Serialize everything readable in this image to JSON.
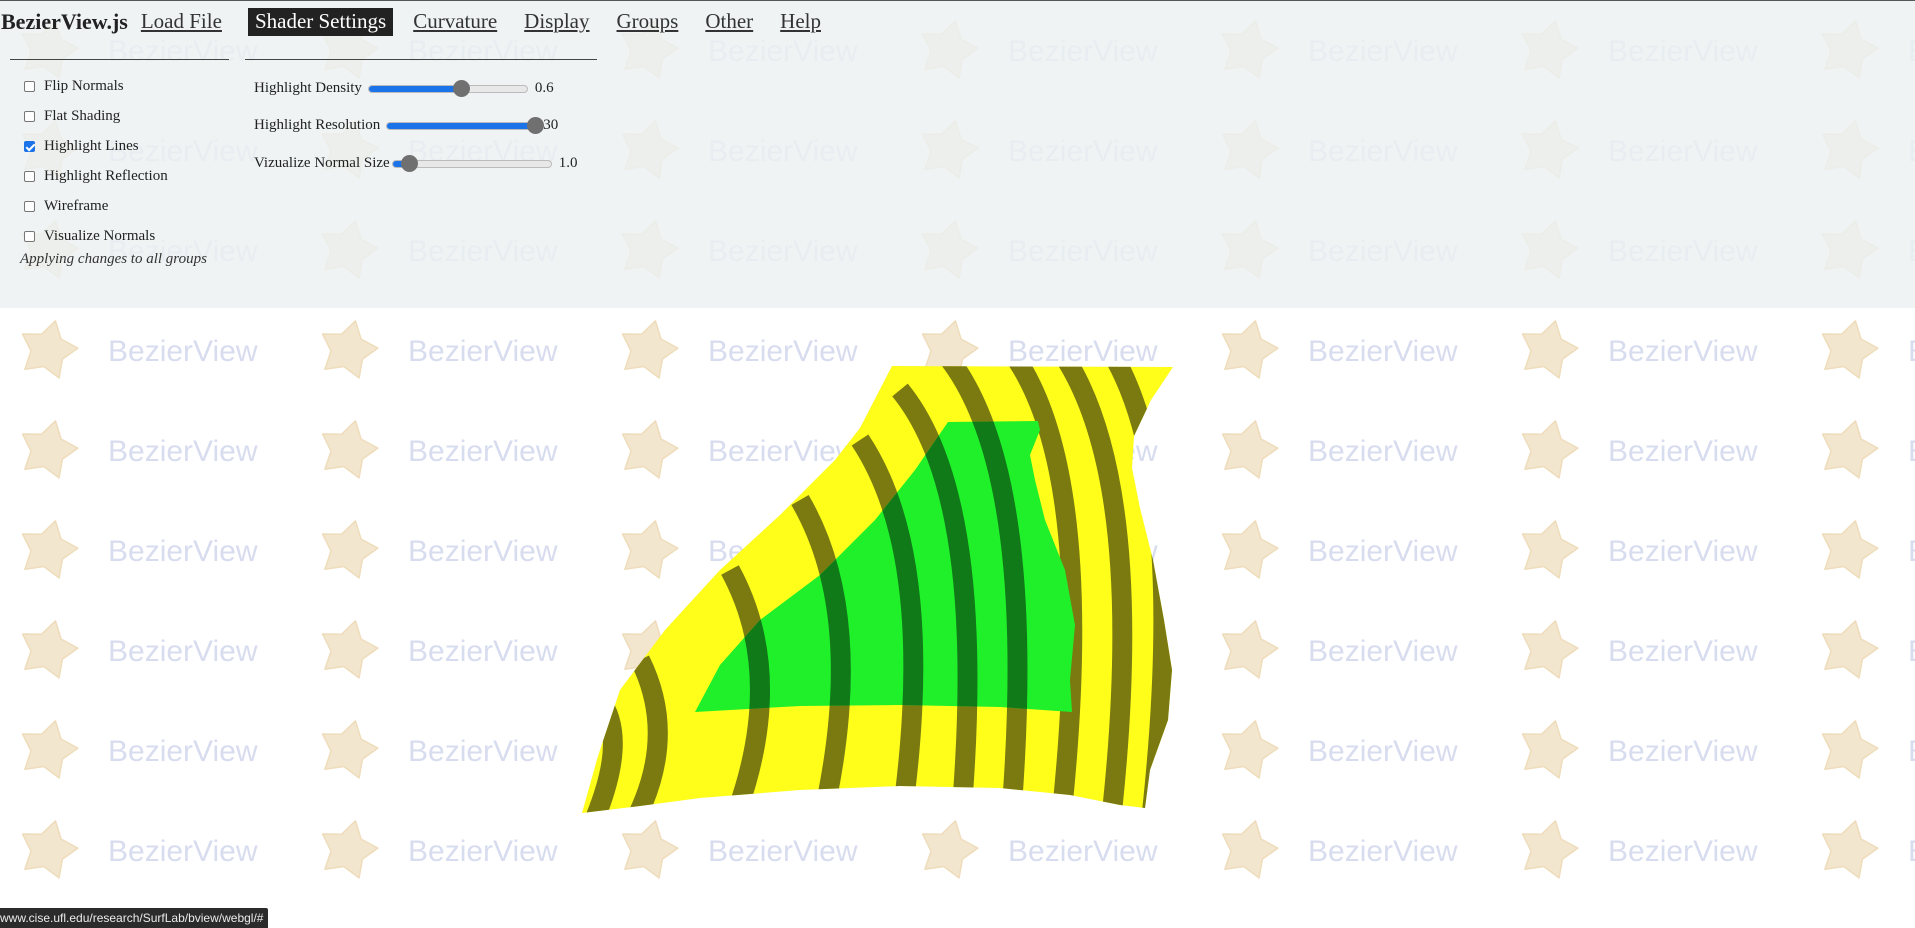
{
  "app": {
    "title": "BezierView.js"
  },
  "menu": {
    "items": [
      {
        "label": "Load File",
        "active": false
      },
      {
        "label": "Shader Settings",
        "active": true
      },
      {
        "label": "Curvature",
        "active": false
      },
      {
        "label": "Display",
        "active": false
      },
      {
        "label": "Groups",
        "active": false
      },
      {
        "label": "Other",
        "active": false
      },
      {
        "label": "Help",
        "active": false
      }
    ]
  },
  "shader": {
    "checkboxes": [
      {
        "label": "Flip Normals",
        "checked": false
      },
      {
        "label": "Flat Shading",
        "checked": false
      },
      {
        "label": "Highlight Lines",
        "checked": true
      },
      {
        "label": "Highlight Reflection",
        "checked": false
      },
      {
        "label": "Wireframe",
        "checked": false
      },
      {
        "label": "Visualize Normals",
        "checked": false
      }
    ],
    "apply_note": "Applying changes to all groups",
    "sliders": [
      {
        "label": "Highlight Density",
        "value": "0.6",
        "fraction": 0.58
      },
      {
        "label": "Highlight Resolution",
        "value": "30",
        "fraction": 1.0
      },
      {
        "label": "Vizualize Normal Size",
        "value": "1.0",
        "fraction": 0.1
      }
    ]
  },
  "watermark": {
    "text": "BezierView",
    "text_color": "#d8dcef",
    "star_color": "#f3e6cf"
  },
  "surface": {
    "colors": {
      "yellow": "#fefe1a",
      "green": "#1ff02a",
      "dark_band": "#7a7a10",
      "dark_green_band": "#107a18"
    }
  },
  "status_bar": {
    "url": "www.cise.ufl.edu/research/SurfLab/bview/webgl/#"
  }
}
